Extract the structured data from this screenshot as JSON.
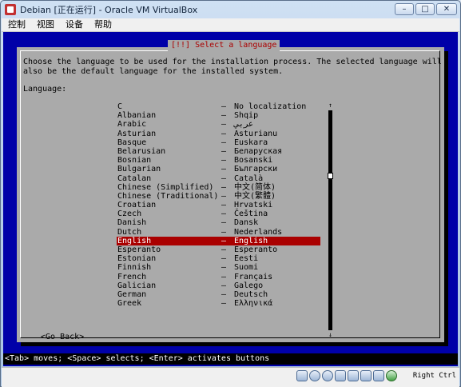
{
  "window": {
    "title": "Debian [正在运行] - Oracle VM VirtualBox",
    "minimize": "–",
    "maximize": "□",
    "close": "✕"
  },
  "menu": [
    "控制",
    "视图",
    "设备",
    "帮助"
  ],
  "installer": {
    "title": "[!!] Select a language",
    "intro_line1": "Choose the language to be used for the installation process. The selected language will",
    "intro_line2": "also be the default language for the installed system.",
    "list_label": "Language:",
    "languages": [
      {
        "name": "C",
        "native": "No localization"
      },
      {
        "name": "Albanian",
        "native": "Shqip"
      },
      {
        "name": "Arabic",
        "native": "عربي"
      },
      {
        "name": "Asturian",
        "native": "Asturianu"
      },
      {
        "name": "Basque",
        "native": "Euskara"
      },
      {
        "name": "Belarusian",
        "native": "Беларуская"
      },
      {
        "name": "Bosnian",
        "native": "Bosanski"
      },
      {
        "name": "Bulgarian",
        "native": "Български"
      },
      {
        "name": "Catalan",
        "native": "Català"
      },
      {
        "name": "Chinese (Simplified)",
        "native": "中文(简体)"
      },
      {
        "name": "Chinese (Traditional)",
        "native": "中文(繁體)"
      },
      {
        "name": "Croatian",
        "native": "Hrvatski"
      },
      {
        "name": "Czech",
        "native": "Čeština"
      },
      {
        "name": "Danish",
        "native": "Dansk"
      },
      {
        "name": "Dutch",
        "native": "Nederlands"
      },
      {
        "name": "English",
        "native": "English"
      },
      {
        "name": "Esperanto",
        "native": "Esperanto"
      },
      {
        "name": "Estonian",
        "native": "Eesti"
      },
      {
        "name": "Finnish",
        "native": "Suomi"
      },
      {
        "name": "French",
        "native": "Français"
      },
      {
        "name": "Galician",
        "native": "Galego"
      },
      {
        "name": "German",
        "native": "Deutsch"
      },
      {
        "name": "Greek",
        "native": "Ελληνικά"
      }
    ],
    "selected": "English",
    "separator": "–",
    "scroll_up": "↑",
    "scroll_down": "↓",
    "go_back": "<Go Back>",
    "help": "<Tab> moves; <Space> selects; <Enter> activates buttons"
  },
  "statusbar": {
    "icons": [
      "hard-disk-icon",
      "optical-drive-icon",
      "usb-icon",
      "shared-folders-icon",
      "network-icon",
      "display-icon",
      "video-capture-icon",
      "mouse-integration-icon"
    ],
    "host_key": "Right Ctrl"
  },
  "colors": {
    "screen_bg": "#0000a8",
    "dialog_bg": "#aaaaaa",
    "selected_bg": "#aa0000",
    "title_fg": "#aa0000"
  }
}
